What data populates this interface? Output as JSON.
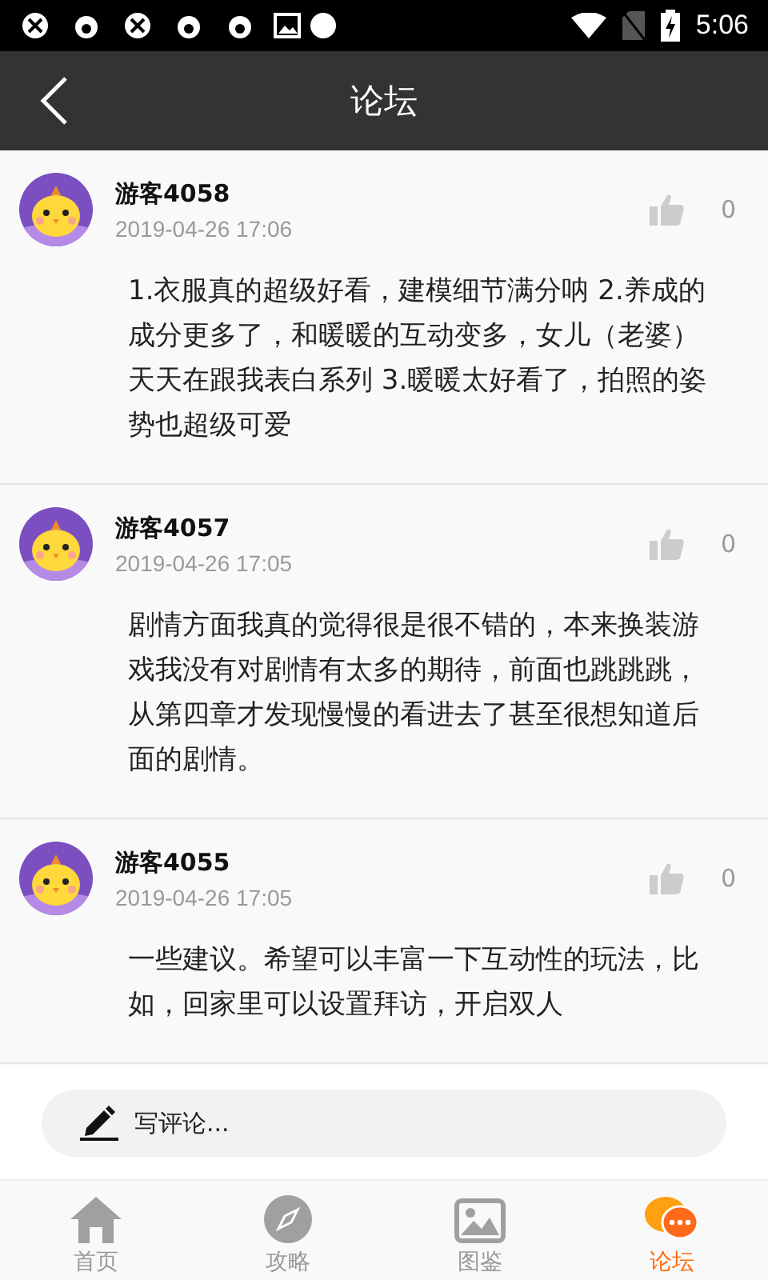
{
  "status_bar": {
    "time": "5:06"
  },
  "header": {
    "title": "论坛"
  },
  "posts": [
    {
      "user": "游客4058",
      "time": "2019-04-26 17:06",
      "likes": "0",
      "text": "1.衣服真的超级好看，建模细节满分呐 2.养成的成分更多了，和暖暖的互动变多，女儿（老婆）天天在跟我表白系列 3.暖暖太好看了，拍照的姿势也超级可爱"
    },
    {
      "user": "游客4057",
      "time": "2019-04-26 17:05",
      "likes": "0",
      "text": "剧情方面我真的觉得很是很不错的，本来换装游戏我没有对剧情有太多的期待，前面也跳跳跳，从第四章才发现慢慢的看进去了甚至很想知道后面的剧情。"
    },
    {
      "user": "游客4055",
      "time": "2019-04-26 17:05",
      "likes": "0",
      "text": "一些建议。希望可以丰富一下互动性的玩法，比如，回家里可以设置拜访，开启双人"
    }
  ],
  "comment_box": {
    "placeholder": "写评论..."
  },
  "tabs": [
    {
      "label": "首页",
      "kind": "home",
      "selected": false
    },
    {
      "label": "攻略",
      "kind": "compass",
      "selected": false
    },
    {
      "label": "图鉴",
      "kind": "image",
      "selected": false
    },
    {
      "label": "论坛",
      "kind": "chat",
      "selected": true
    }
  ]
}
